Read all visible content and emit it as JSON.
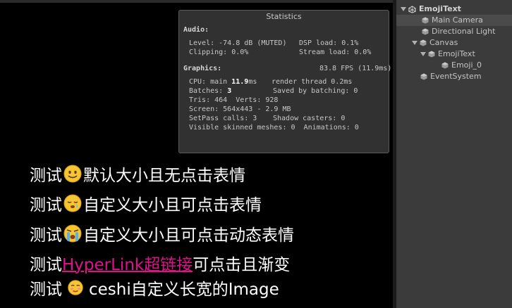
{
  "statistics": {
    "title": "Statistics",
    "audio_label": "Audio:",
    "audio_level": "Level: -74.8 dB (MUTED)",
    "dsp_load": "DSP load: 0.1%",
    "clipping": "Clipping: 0.0%",
    "stream_load": "Stream load: 0.0%",
    "graphics_label": "Graphics:",
    "fps": "83.8 FPS (11.9ms)",
    "cpu_main_prefix": "CPU: main ",
    "cpu_main_value": "11.9",
    "cpu_main_suffix": "ms",
    "render_thread": "render thread 0.2ms",
    "batches_prefix": "Batches: ",
    "batches_value": "3",
    "saved_by_batching": "Saved by batching: 0",
    "tris_verts": "Tris: 464  Verts: 928",
    "screen": "Screen: 564x443 - 2.9 MB",
    "setpass": "SetPass calls: 3",
    "shadow_casters": "Shadow casters: 0",
    "visible_skinned": "Visible skinned meshes: 0  Animations: 0"
  },
  "game_text": {
    "line1_prefix": "测试",
    "line1_suffix": "默认大小且无点击表情",
    "line2_prefix": "测试",
    "line2_suffix": "自定义大小且可点击表情",
    "line3_prefix": "测试",
    "line3_suffix": "自定义大小且可点击动态表情",
    "line4_prefix": "测试",
    "line4_link": "HyperLink超链接",
    "line4_suffix": "可点击且渐变",
    "line5_prefix": "测试",
    "line5_suffix": "ceshi自定义长宽的Image"
  },
  "hierarchy": {
    "scene": "EmojiText",
    "items": [
      {
        "label": "Main Camera"
      },
      {
        "label": "Directional Light"
      },
      {
        "label": "Canvas"
      },
      {
        "label": "EmojiText"
      },
      {
        "label": "Emoji_0"
      },
      {
        "label": "EventSystem"
      }
    ]
  },
  "colors": {
    "hyperlink": "#e0108c",
    "emoji_face": "#f7c531"
  },
  "icons": [
    "smile-emoji",
    "sleepy-emoji",
    "crying-emoji",
    "smirk-emoji",
    "cube-icon",
    "unity-scene-icon"
  ]
}
